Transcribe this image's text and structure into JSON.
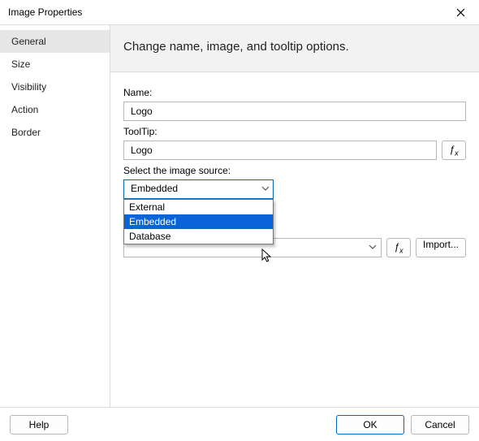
{
  "title": "Image Properties",
  "sidebar": {
    "items": [
      {
        "label": "General"
      },
      {
        "label": "Size"
      },
      {
        "label": "Visibility"
      },
      {
        "label": "Action"
      },
      {
        "label": "Border"
      }
    ],
    "selected_index": 0
  },
  "main": {
    "heading": "Change name, image, and tooltip options.",
    "name_label": "Name:",
    "name_value": "Logo",
    "tooltip_label": "ToolTip:",
    "tooltip_value": "Logo",
    "source_label": "Select the image source:",
    "source_selected": "Embedded",
    "source_options": [
      "External",
      "Embedded",
      "Database"
    ],
    "fx_label": "fx",
    "import_label": "Import..."
  },
  "footer": {
    "help": "Help",
    "ok": "OK",
    "cancel": "Cancel"
  }
}
